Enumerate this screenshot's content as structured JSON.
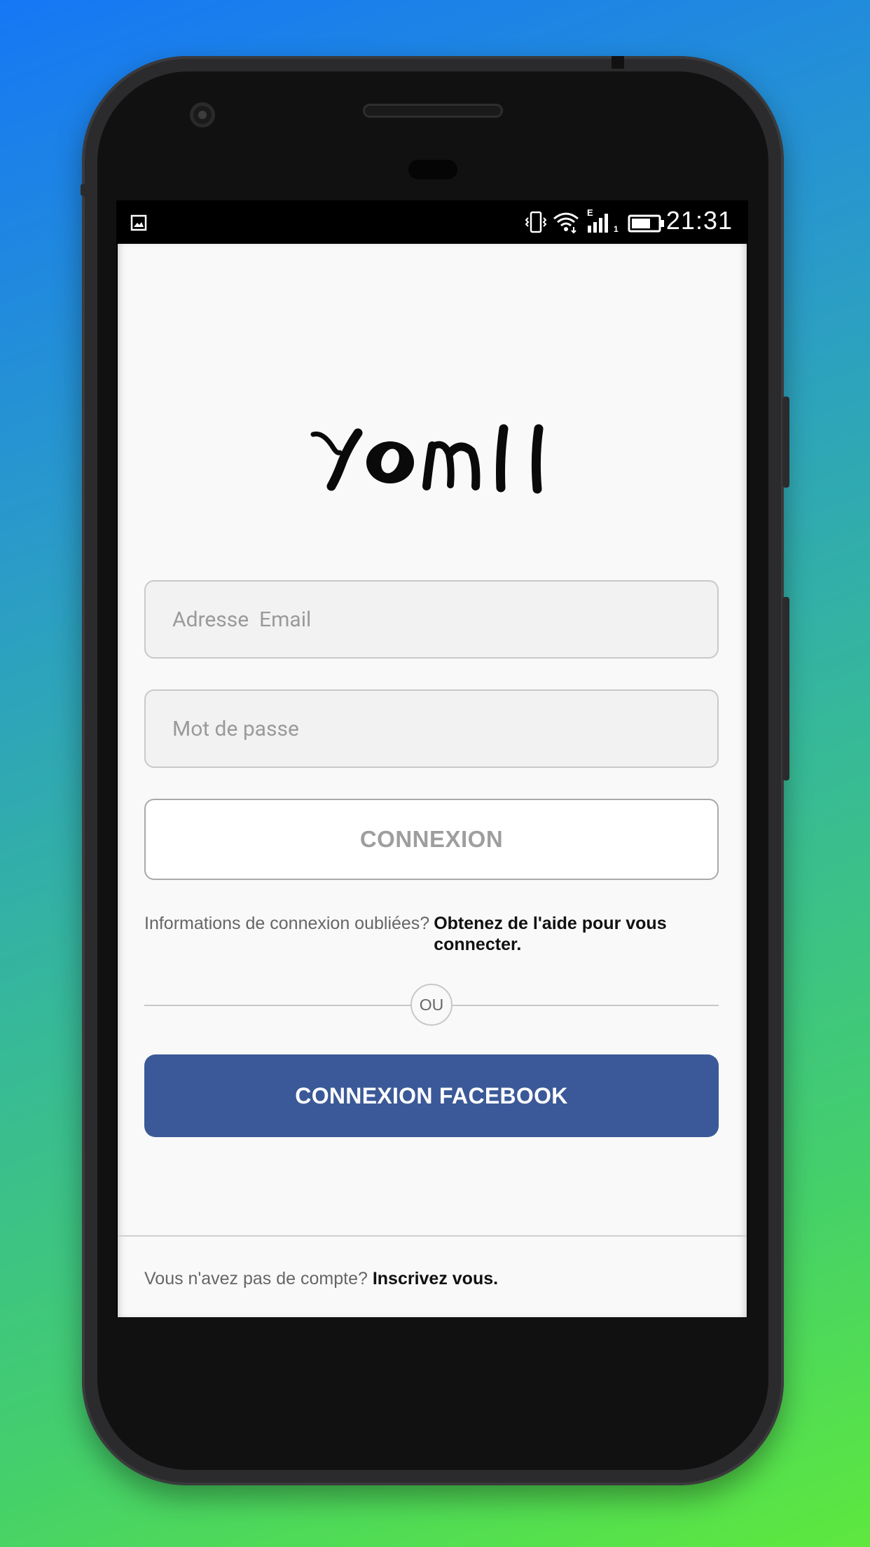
{
  "status_bar": {
    "time": "21:31",
    "icons": [
      "image-icon",
      "vibrate-icon",
      "wifi-icon",
      "signal-icon",
      "battery-icon"
    ],
    "network_label": "E",
    "sim_label": "1"
  },
  "app": {
    "logo_text": "YOMII",
    "email_placeholder": "Adresse  Email",
    "password_placeholder": "Mot de passe",
    "login_button": "CONNEXION",
    "forgot_question": "Informations de connexion oubliées?",
    "forgot_link": "Obtenez de l'aide pour vous connecter.",
    "divider_label": "OU",
    "facebook_button": "CONNEXION FACEBOOK",
    "signup_question": "Vous n'avez pas de compte?",
    "signup_link": "Inscrivez vous.",
    "facebook_color": "#3b5998"
  }
}
